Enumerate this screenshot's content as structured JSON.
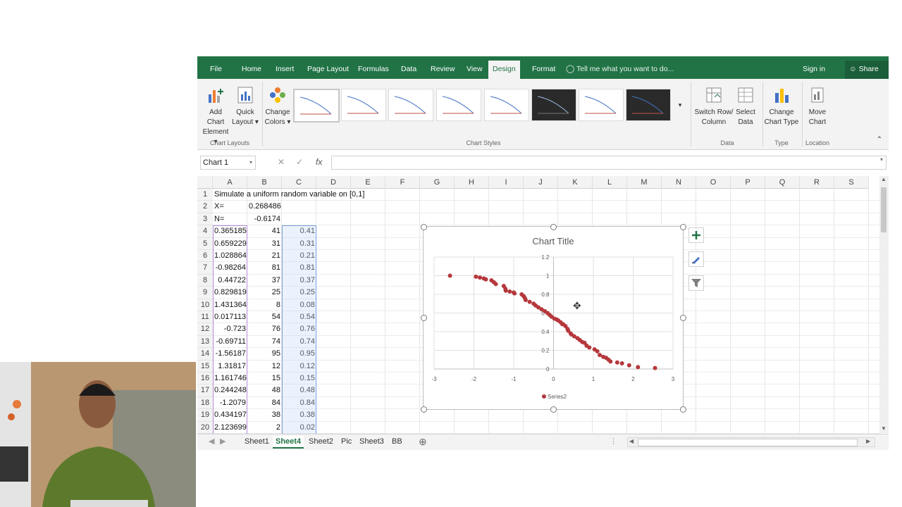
{
  "ribbon": {
    "tabs": [
      "File",
      "Home",
      "Insert",
      "Page Layout",
      "Formulas",
      "Data",
      "Review",
      "View",
      "Design",
      "Format"
    ],
    "active_tab": "Design",
    "tell_me": "Tell me what you want to do...",
    "sign_in": "Sign in",
    "share": "Share",
    "buttons": {
      "add_chart_element": [
        "Add Chart",
        "Element ▾"
      ],
      "quick_layout": [
        "Quick",
        "Layout ▾"
      ],
      "change_colors": [
        "Change",
        "Colors ▾"
      ],
      "switch_row_column": [
        "Switch Row/",
        "Column"
      ],
      "select_data": [
        "Select",
        "Data"
      ],
      "change_chart_type": [
        "Change",
        "Chart Type"
      ],
      "move_chart": [
        "Move",
        "Chart"
      ]
    },
    "groups": {
      "chart_layouts": "Chart Layouts",
      "chart_styles": "Chart Styles",
      "data": "Data",
      "type": "Type",
      "location": "Location"
    }
  },
  "formula_bar": {
    "name_box": "Chart 1",
    "fx": "fx",
    "value": ""
  },
  "grid": {
    "columns": [
      "A",
      "B",
      "C",
      "D",
      "E",
      "F",
      "G",
      "H",
      "I",
      "J",
      "K",
      "L",
      "M",
      "N",
      "O",
      "P",
      "Q",
      "R",
      "S"
    ],
    "rows": [
      {
        "n": "1",
        "a": "Simulate a uniform random variable on [0,1]",
        "b": "",
        "c": ""
      },
      {
        "n": "2",
        "a": "X=",
        "b": "0.268486",
        "c": ""
      },
      {
        "n": "3",
        "a": "N=",
        "b": "-0.6174",
        "c": ""
      },
      {
        "n": "4",
        "a": "0.365185",
        "b": "41",
        "c": "0.41"
      },
      {
        "n": "5",
        "a": "0.659229",
        "b": "31",
        "c": "0.31"
      },
      {
        "n": "6",
        "a": "1.028864",
        "b": "21",
        "c": "0.21"
      },
      {
        "n": "7",
        "a": "-0.98264",
        "b": "81",
        "c": "0.81"
      },
      {
        "n": "8",
        "a": "0.44722",
        "b": "37",
        "c": "0.37"
      },
      {
        "n": "9",
        "a": "0.829819",
        "b": "25",
        "c": "0.25"
      },
      {
        "n": "10",
        "a": "1.431364",
        "b": "8",
        "c": "0.08"
      },
      {
        "n": "11",
        "a": "0.017113",
        "b": "54",
        "c": "0.54"
      },
      {
        "n": "12",
        "a": "-0.723",
        "b": "76",
        "c": "0.76"
      },
      {
        "n": "13",
        "a": "-0.69711",
        "b": "74",
        "c": "0.74"
      },
      {
        "n": "14",
        "a": "-1.56187",
        "b": "95",
        "c": "0.95"
      },
      {
        "n": "15",
        "a": "1.31817",
        "b": "12",
        "c": "0.12"
      },
      {
        "n": "16",
        "a": "1.161746",
        "b": "15",
        "c": "0.15"
      },
      {
        "n": "17",
        "a": "0.244248",
        "b": "48",
        "c": "0.48"
      },
      {
        "n": "18",
        "a": "-1.2079",
        "b": "84",
        "c": "0.84"
      },
      {
        "n": "19",
        "a": "0.434197",
        "b": "38",
        "c": "0.38"
      },
      {
        "n": "20",
        "a": "2.123699",
        "b": "2",
        "c": "0.02"
      }
    ]
  },
  "sheets": [
    "Sheet1",
    "Sheet4",
    "Sheet2",
    "Pic",
    "Sheet3",
    "BB"
  ],
  "active_sheet": "Sheet4",
  "chart_data": {
    "type": "scatter",
    "title": "Chart Title",
    "legend": "Series2",
    "legend_position": "bottom",
    "xlim": [
      -3,
      3
    ],
    "ylim": [
      0,
      1.2
    ],
    "xticks": [
      "-3",
      "-2",
      "-1",
      "0",
      "1",
      "2",
      "3"
    ],
    "yticks": [
      "0",
      "0.2",
      "0.4",
      "0.6",
      "0.8",
      "1",
      "1.2"
    ],
    "grid": true,
    "color": "#b5373c",
    "points": [
      [
        -2.6,
        1.0
      ],
      [
        -1.95,
        0.99
      ],
      [
        -1.85,
        0.98
      ],
      [
        -1.75,
        0.97
      ],
      [
        -1.7,
        0.96
      ],
      [
        -1.56,
        0.95
      ],
      [
        -1.5,
        0.93
      ],
      [
        -1.45,
        0.91
      ],
      [
        -1.25,
        0.89
      ],
      [
        -1.21,
        0.86
      ],
      [
        -1.2,
        0.84
      ],
      [
        -1.1,
        0.83
      ],
      [
        -1.0,
        0.82
      ],
      [
        -0.98,
        0.81
      ],
      [
        -0.8,
        0.8
      ],
      [
        -0.75,
        0.78
      ],
      [
        -0.72,
        0.76
      ],
      [
        -0.7,
        0.74
      ],
      [
        -0.6,
        0.72
      ],
      [
        -0.5,
        0.7
      ],
      [
        -0.45,
        0.68
      ],
      [
        -0.38,
        0.66
      ],
      [
        -0.3,
        0.64
      ],
      [
        -0.22,
        0.62
      ],
      [
        -0.15,
        0.6
      ],
      [
        -0.1,
        0.58
      ],
      [
        -0.05,
        0.56
      ],
      [
        0.02,
        0.54
      ],
      [
        0.08,
        0.53
      ],
      [
        0.12,
        0.52
      ],
      [
        0.18,
        0.5
      ],
      [
        0.22,
        0.48
      ],
      [
        0.24,
        0.48
      ],
      [
        0.3,
        0.46
      ],
      [
        0.35,
        0.43
      ],
      [
        0.37,
        0.41
      ],
      [
        0.43,
        0.38
      ],
      [
        0.45,
        0.37
      ],
      [
        0.52,
        0.35
      ],
      [
        0.6,
        0.33
      ],
      [
        0.66,
        0.31
      ],
      [
        0.72,
        0.29
      ],
      [
        0.78,
        0.28
      ],
      [
        0.83,
        0.25
      ],
      [
        0.9,
        0.23
      ],
      [
        1.03,
        0.21
      ],
      [
        1.1,
        0.19
      ],
      [
        1.16,
        0.15
      ],
      [
        1.25,
        0.13
      ],
      [
        1.32,
        0.12
      ],
      [
        1.38,
        0.1
      ],
      [
        1.43,
        0.08
      ],
      [
        1.6,
        0.07
      ],
      [
        1.72,
        0.06
      ],
      [
        1.9,
        0.04
      ],
      [
        2.12,
        0.02
      ],
      [
        2.55,
        0.01
      ]
    ]
  }
}
